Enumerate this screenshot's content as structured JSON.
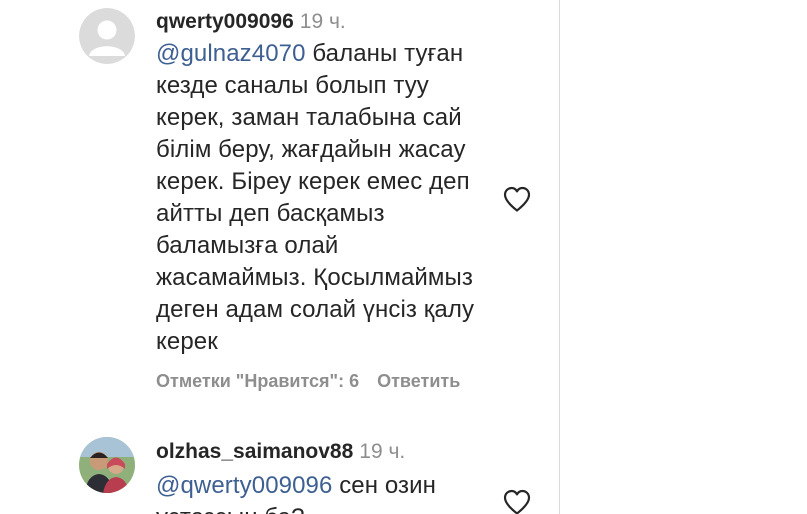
{
  "comments": [
    {
      "username": "qwerty009096",
      "time": "19 ч.",
      "mention": "@gulnaz4070",
      "text_lines": [
        " баланы туған",
        "кезде саналы болып туу",
        "керек, заман талабына сай",
        "білім беру, жағдайын жасау",
        "керек. Біреу керек емес деп",
        "айтты деп басқамыз",
        "баламызға олай",
        "жасамаймыз. Қосылмаймыз",
        "деген адам солай үнсіз қалу",
        "керек"
      ],
      "likes_label": "Отметки \"Нравится\": 6",
      "reply_label": "Ответить",
      "avatar_icon": "default-avatar-icon",
      "like_icon": "heart-outline-icon"
    },
    {
      "username": "olzhas_saimanov88",
      "time": "19 ч.",
      "mention": "@qwerty009096",
      "text_lines": [
        " сен озин",
        "устазсын ба?"
      ],
      "avatar_icon": "user-photo-avatar",
      "like_icon": "heart-outline-icon"
    }
  ],
  "colors": {
    "mention": "#3d5f91",
    "muted": "#8e8e8e",
    "text": "#262626",
    "divider": "#dbdbdb"
  }
}
